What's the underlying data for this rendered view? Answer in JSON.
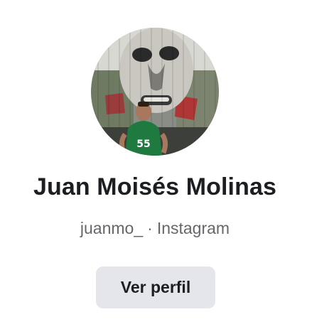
{
  "profile": {
    "name": "Juan Moisés Molinas",
    "username": "juanmo_",
    "separator": "·",
    "platform": "Instagram",
    "view_button_label": "Ver perfil",
    "avatar_icon": "profile-photo-avatar"
  },
  "colors": {
    "name_text": "#1c1e21",
    "secondary_text": "#65676b",
    "button_bg": "#e4e6eb",
    "shirt": "#1f7a3f"
  }
}
